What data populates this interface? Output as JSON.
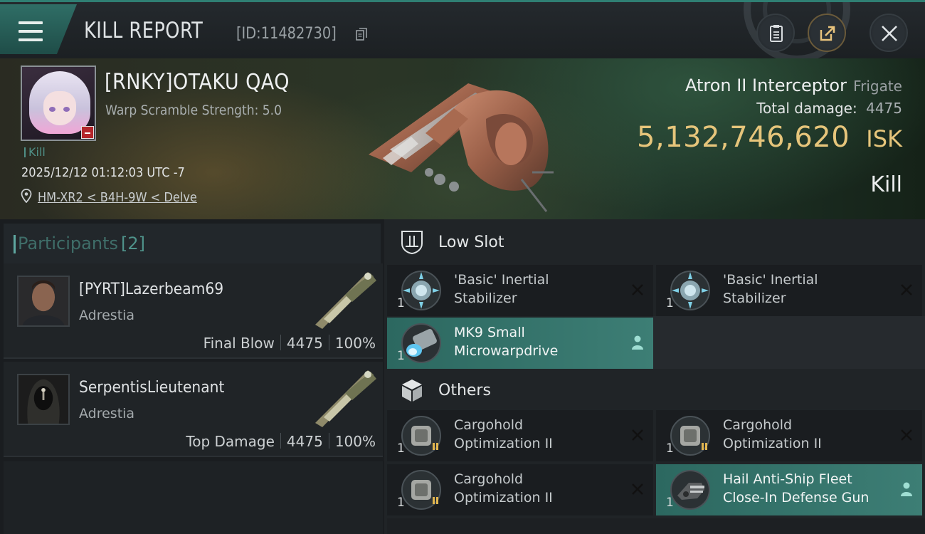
{
  "header": {
    "title": "KILL REPORT",
    "report_id": "[ID:11482730]",
    "icons": [
      "menu-icon",
      "copy-icon",
      "notes-icon",
      "share-icon",
      "close-icon"
    ]
  },
  "victim": {
    "name": "[RNKY]OTAKU QAQ",
    "warp_scramble": "Warp Scramble Strength: 5.0",
    "tag": "Kill",
    "datetime": "2025/12/12 01:12:03 UTC -7",
    "location": "HM-XR2 < B4H-9W < Delve"
  },
  "ship": {
    "name": "Atron II Interceptor",
    "class": "Frigate",
    "damage_label": "Total damage:",
    "damage_value": "4475",
    "isk_value": "5,132,746,620",
    "isk_unit": "ISK",
    "outcome": "Kill"
  },
  "participants": {
    "label": "Participants",
    "count": "[2]",
    "rows": [
      {
        "name": "[PYRT]Lazerbeam69",
        "corp": "Adrestia",
        "role": "Final Blow",
        "damage": "4475",
        "percent": "100%"
      },
      {
        "name": "SerpentisLieutenant",
        "corp": "Adrestia",
        "role": "Top Damage",
        "damage": "4475",
        "percent": "100%"
      }
    ]
  },
  "fitting": {
    "low_slot": {
      "label": "Low Slot",
      "items": [
        {
          "qty": "1",
          "line1": "'Basic' Inertial",
          "line2": "Stabilizer",
          "status": "destroyed"
        },
        {
          "qty": "1",
          "line1": "'Basic' Inertial",
          "line2": "Stabilizer",
          "status": "destroyed"
        },
        {
          "qty": "1",
          "line1": "MK9 Small",
          "line2": "Microwarpdrive",
          "status": "dropped"
        }
      ]
    },
    "others": {
      "label": "Others",
      "items": [
        {
          "qty": "1",
          "line1": "Cargohold",
          "line2": "Optimization II",
          "status": "destroyed"
        },
        {
          "qty": "1",
          "line1": "Cargohold",
          "line2": "Optimization II",
          "status": "destroyed"
        },
        {
          "qty": "1",
          "line1": "Cargohold",
          "line2": "Optimization II",
          "status": "destroyed"
        },
        {
          "qty": "1",
          "line1": "Hail Anti-Ship Fleet",
          "line2": "Close-In Defense Gun",
          "status": "dropped"
        }
      ]
    }
  },
  "colors": {
    "accent": "#2f7f73",
    "isk": "#e6c57b",
    "dropped_bg": "#3d7e75",
    "destroyed_bg": "#1a1d20"
  }
}
